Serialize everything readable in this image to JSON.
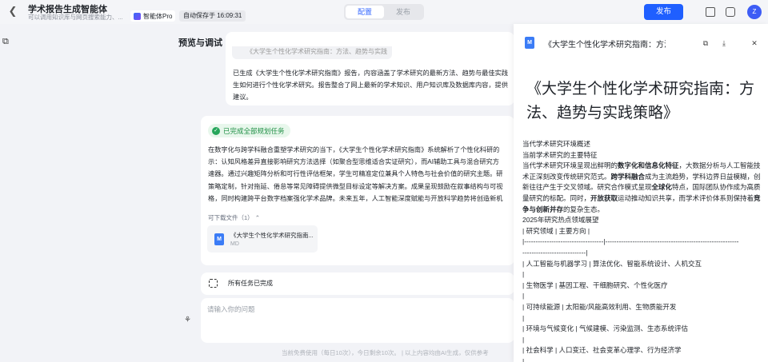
{
  "header": {
    "app_title": "学术报告生成智能体",
    "app_subtitle": "可以调用知识库与网页搜索能力、...",
    "agent_badge": "智能体Pro",
    "autosave": "自动保存于 16:09:31",
    "tabs": [
      "配置",
      "发布"
    ],
    "publish_label": "发布",
    "avatar_letter": "Z"
  },
  "main": {
    "section_title": "预览与调试",
    "faded_pill": "《大学生个性化学术研究指南：方法、趋势与实践",
    "summary_lines": [
      "已生成《大学生个性化学术研究指南》报告，内容涵盖了学术研究的最新方法、趋势与最佳实践",
      "生如何进行个性化学术研究。报告整合了网上最新的学术知识、用户知识库及数据库内容，提供",
      "建议。"
    ],
    "done_badge": "已完成全部规划任务",
    "plan_lines": [
      "在数字化与跨学科融合重塑学术研究的当下，《大学生个性化学术研究指南》系统解析了个性化科研的",
      "示：认知风格差异直接影响研究方法选择（如聚合型思维适合实证研究），而AI辅助工具与混合研究方",
      "速器。通过兴趣矩阵分析和可行性评估框架，学生可精准定位兼具个人特色与社会价值的研究主题。研",
      "策略定制，针对拖延、倦怠等常见障碍提供微型目标设定等解决方案。成果呈现鼓励在叙事结构与可视",
      "格，同时构建跨平台数字档案强化学术品牌。未来五年，人工智能深度赋能与开放科学趋势将创造新机"
    ],
    "downloads_label": "可下载文件（1）",
    "file_name": "《大学生个性化学术研究指南...",
    "file_type": "MD",
    "status_text": "所有任务已完成",
    "input_placeholder": "请输入你的问题",
    "footer": "当前免费使用（每日10次），今日剩余10次。 | 以上内容均由AI生成，仅供参考"
  },
  "doc": {
    "title": "《大学生个性化学术研究指南：方法、趋势与实践策略》",
    "heading": "《大学生个性化学术研究指南：方法、趋势与实践策略》",
    "section1": "当代学术研究环境概述",
    "section1_sub": "当前学术研究的主要特征",
    "para": [
      {
        "t": "当代学术研究环境呈现出鲜明的"
      },
      {
        "b": "数字化和信息化特征"
      },
      {
        "t": "，大数据分析与人工智能技术正深刻改变传统研究范式。"
      },
      {
        "b": "跨学科融合"
      },
      {
        "t": "成为主流趋势，学科边界日益模糊，创新往往产生于交叉领域。研究合作模式呈现"
      },
      {
        "b": "全球化"
      },
      {
        "t": "特点，国际团队协作成为高质量研究的标配。同时，"
      },
      {
        "b": "开放获取"
      },
      {
        "t": "运动推动知识共享，而学术评价体系则保持着"
      },
      {
        "b": "竞争与创新并存"
      },
      {
        "t": "的复杂生态。"
      }
    ],
    "table_title": "2025年研究热点领域展望",
    "table_header": [
      "研究领域",
      "主要方向"
    ],
    "table_rows": [
      [
        "人工智能与机器学习",
        "算法优化、智能系统设计、人机交互"
      ],
      [
        "生物医学",
        "基因工程、干细胞研究、个性化医疗"
      ],
      [
        "可持续能源",
        "太阳能/风能高效利用、生物质能开发"
      ],
      [
        "环境与气候变化",
        "气候建模、污染监测、生态系统评估"
      ],
      [
        "社会科学",
        "人口变迁、社会变革心理学、行为经济学"
      ]
    ]
  }
}
